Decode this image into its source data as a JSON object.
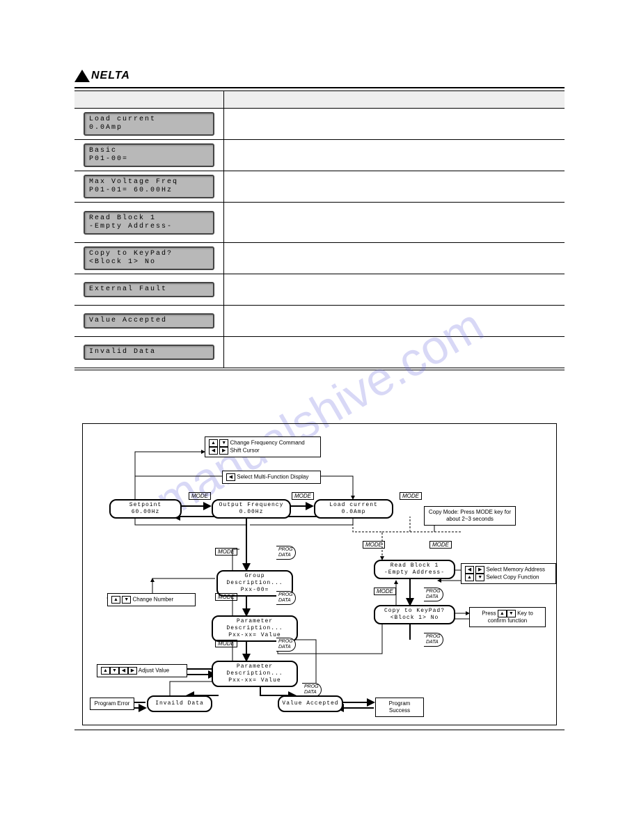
{
  "logo": {
    "text": "NELTA"
  },
  "table": {
    "rows": [
      {
        "l1": "Load current",
        "l2": "        0.0Amp"
      },
      {
        "l1": "Basic",
        "l2": "P01-00="
      },
      {
        "l1": "Max Voltage Freq",
        "l2": "P01-01= 60.00Hz"
      },
      {
        "l1": "Read  Block  1",
        "l2": "-Empty Address-"
      },
      {
        "l1": "Copy to KeyPad?",
        "l2": "<Block 1>  No"
      },
      {
        "l1": "External Fault",
        "l2": ""
      },
      {
        "l1": "Value Accepted",
        "l2": ""
      },
      {
        "l1": "Invalid Data",
        "l2": ""
      }
    ]
  },
  "watermark": "manualshive.com",
  "flow": {
    "topbox": {
      "t1": "Change Frequency Command",
      "t2": "Shift Cursor"
    },
    "selmulti": "Select Multi-Function Display",
    "mode": "MODE",
    "progdata": "PROG\nDATA",
    "n_setpoint": {
      "l1": "Setpoint",
      "l2": "      60.00Hz"
    },
    "n_outfreq": {
      "l1": "Output Frequency",
      "l2": "      0.00Hz"
    },
    "n_loadcur": {
      "l1": "Load current",
      "l2": "      0.0Amp"
    },
    "n_group": {
      "l1": "Group Description...",
      "l2": "Pxx-00="
    },
    "n_param": {
      "l1": "Parameter Description...",
      "l2": "Pxx-xx= Value"
    },
    "n_param2": {
      "l1": "Parameter Description...",
      "l2": "Pxx-xx= Value"
    },
    "n_read": {
      "l1": "Read  Block  1",
      "l2": "-Empty Address-"
    },
    "n_copy": {
      "l1": "Copy to KeyPad?",
      "l2": "<Block 1>  No"
    },
    "n_invalid": "Invaild Data",
    "n_accepted": "Value Accepted",
    "n_progerr": "Program Error",
    "n_progsuc": "Program Success",
    "changenum": "Change Number",
    "adjustval": "Adjust Value",
    "copynote": "Copy Mode: Press MODE key for about 2~3 seconds",
    "selmem": "Select Memory Address",
    "selcopy": "Select Copy Function",
    "presskey": "Press        Key to confirm function"
  }
}
